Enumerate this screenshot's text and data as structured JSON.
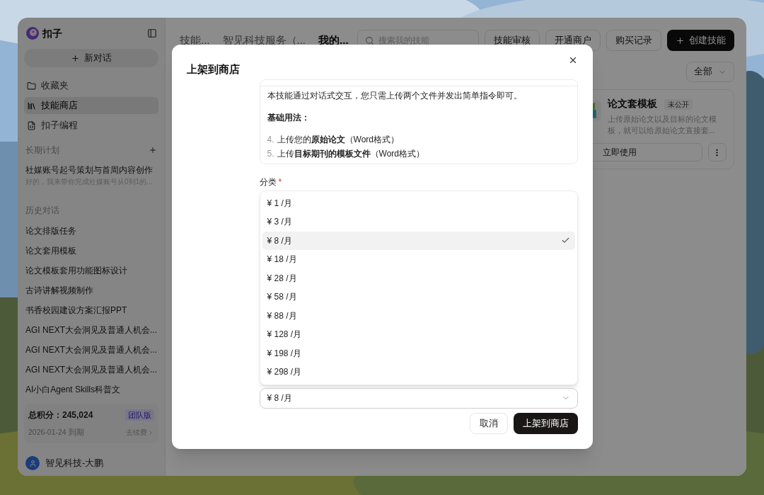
{
  "app": {
    "name": "扣子"
  },
  "sidebar": {
    "new_chat": "新对话",
    "nav": [
      {
        "label": "收藏夹",
        "kind": "folder",
        "selected": false
      },
      {
        "label": "技能商店",
        "kind": "store",
        "selected": true
      },
      {
        "label": "扣子编程",
        "kind": "code",
        "selected": false
      }
    ],
    "plans": {
      "title": "长期计划",
      "items": [
        {
          "title": "社媒账号起号策划与首周内容创作",
          "preview": "好的，我来带你完成社媒账号从0到1的..."
        }
      ]
    },
    "history": {
      "title": "历史对话",
      "items": [
        "论文排版任务",
        "论文套用模板",
        "论文模板套用功能图标设计",
        "古诗讲解视频制作",
        "书香校园建设方案汇报PPT",
        "AGI NEXT大会洞见及普通人机会...",
        "AGI NEXT大会洞见及普通人机会...",
        "AGI NEXT大会洞见及普通人机会...",
        "AI小白Agent Skills科普文"
      ]
    },
    "points": {
      "label": "总积分：245,024",
      "badge": "团队版",
      "expiry": "2026-01-24 到期",
      "renew": "去续费"
    },
    "user": {
      "name": "智见科技-大鹏"
    }
  },
  "main": {
    "tabs": [
      {
        "label": "技能...",
        "selected": false
      },
      {
        "label": "智见科技服务（...",
        "selected": false
      },
      {
        "label": "我的...",
        "selected": true
      }
    ],
    "search": {
      "placeholder": "搜索我的技能"
    },
    "actions": [
      {
        "label": "技能审核",
        "kind": "plain"
      },
      {
        "label": "开通商户",
        "kind": "plain"
      },
      {
        "label": "购买记录",
        "kind": "plain"
      },
      {
        "label": "创建技能",
        "kind": "primary"
      }
    ],
    "filter": "全部",
    "card": {
      "title": "论文套模板",
      "badge": "未公开",
      "description": "上传原始论文以及目标的论文模板，就可以给原始论文直接套...",
      "button": "立即使用"
    }
  },
  "dialog": {
    "title": "上架到商店",
    "description": {
      "intro": "本技能通过对话式交互，您只需上传两个文件并发出简单指令即可。",
      "heading": "基础用法：",
      "steps": [
        {
          "number": "4.",
          "text": "上传您的**原始论文**（Word格式）"
        },
        {
          "number": "5.",
          "text": "上传**目标期刊的模板文件**（Word格式）"
        }
      ]
    },
    "category": {
      "label": "分类",
      "required_mark": "*",
      "value": "¥ 8 /月",
      "options": [
        {
          "label": "¥ 1 /月",
          "selected": false
        },
        {
          "label": "¥ 3 /月",
          "selected": false
        },
        {
          "label": "¥ 8 /月",
          "selected": true
        },
        {
          "label": "¥ 18 /月",
          "selected": false
        },
        {
          "label": "¥ 28 /月",
          "selected": false
        },
        {
          "label": "¥ 58 /月",
          "selected": false
        },
        {
          "label": "¥ 88 /月",
          "selected": false
        },
        {
          "label": "¥ 128 /月",
          "selected": false
        },
        {
          "label": "¥ 198 /月",
          "selected": false
        },
        {
          "label": "¥ 298 /月",
          "selected": false
        }
      ]
    },
    "buttons": [
      {
        "label": "取消",
        "kind": "secondary"
      },
      {
        "label": "上架到商店",
        "kind": "primary"
      }
    ]
  }
}
